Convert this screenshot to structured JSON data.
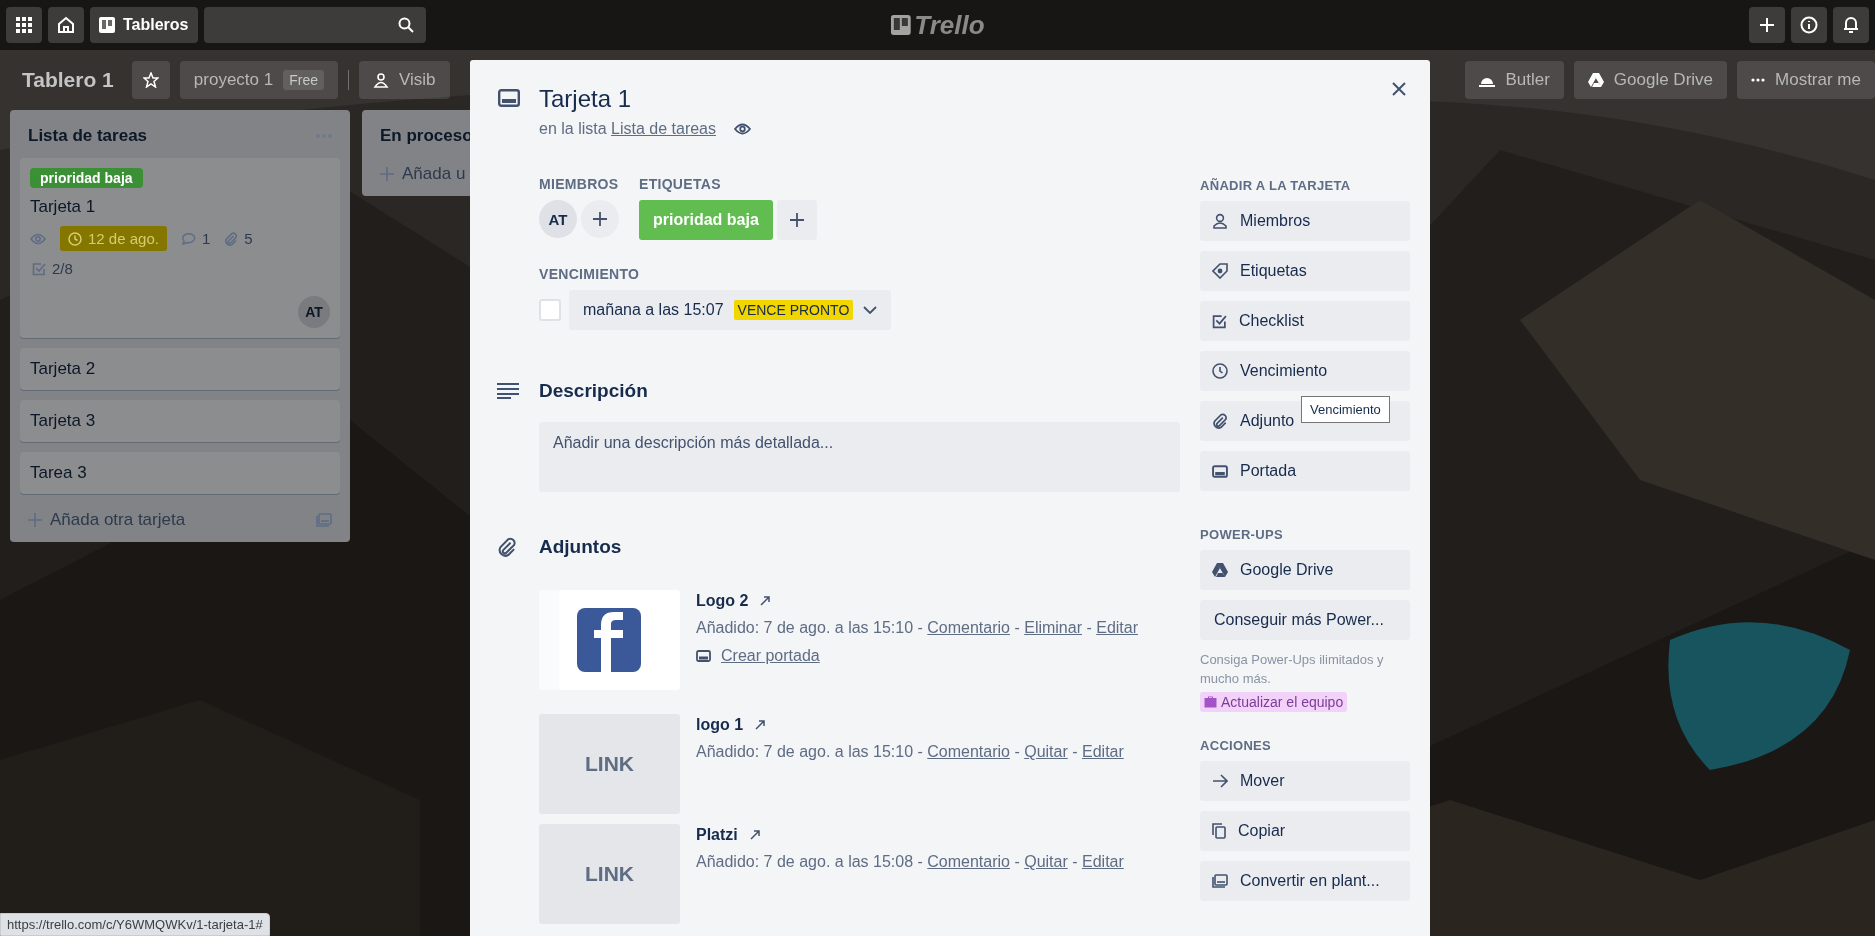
{
  "header": {
    "boards_button": "Tableros",
    "logo": "Trello"
  },
  "board": {
    "title": "Tablero 1",
    "starred": false,
    "team": "proyecto 1",
    "team_plan": "Free",
    "visibility": "Visib",
    "right_buttons": [
      "Butler",
      "Google Drive",
      "Mostrar me"
    ]
  },
  "lists": [
    {
      "title": "Lista de tareas",
      "cards": [
        {
          "title": "Tarjeta 1",
          "labels": [
            {
              "text": "prioridad baja",
              "color": "#3b8f35"
            }
          ],
          "watching": true,
          "due": "12 de ago.",
          "due_soon": true,
          "comments": "1",
          "attachments": "5",
          "checklist": "2/8",
          "members": [
            "AT"
          ]
        },
        {
          "title": "Tarjeta 2"
        },
        {
          "title": "Tarjeta 3"
        },
        {
          "title": "Tarea 3"
        }
      ],
      "add_label": "Añada otra tarjeta"
    },
    {
      "title": "En proceso",
      "add_label": "Añada u"
    }
  ],
  "card_detail": {
    "title": "Tarjeta 1",
    "list_prefix": "en la lista",
    "list_name": "Lista de tareas",
    "watching": true,
    "members_heading": "MIEMBROS",
    "members": [
      "AT"
    ],
    "labels_heading": "ETIQUETAS",
    "labels": [
      {
        "text": "prioridad baja",
        "color": "#61bd4f"
      }
    ],
    "due_heading": "VENCIMIENTO",
    "due_complete": false,
    "due_date": "mañana a las 15:07",
    "due_badge": "VENCE PRONTO",
    "description_heading": "Descripción",
    "description_placeholder": "Añadir una descripción más detallada...",
    "attachments_heading": "Adjuntos",
    "separator": "-",
    "attachments": [
      {
        "name": "Logo 2",
        "thumb": {
          "kind": "picture"
        },
        "added": "Añadido: 7 de ago. a las 15:10",
        "actions": [
          "Comentario",
          "Eliminar",
          "Editar"
        ],
        "cover_link": "Crear portada"
      },
      {
        "name": "logo 1",
        "thumb": {
          "kind": "link",
          "text": "LINK"
        },
        "added": "Añadido: 7 de ago. a las 15:10",
        "actions": [
          "Comentario",
          "Quitar",
          "Editar"
        ]
      },
      {
        "name": "Platzi",
        "thumb": {
          "kind": "link",
          "text": "LINK"
        },
        "added": "Añadido: 7 de ago. a las 15:08",
        "actions": [
          "Comentario",
          "Quitar",
          "Editar"
        ]
      }
    ]
  },
  "sidebar": [
    {
      "title": "AÑADIR A LA TARJETA",
      "buttons": [
        {
          "label": "Miembros"
        },
        {
          "label": "Etiquetas"
        },
        {
          "label": "Checklist"
        },
        {
          "label": "Vencimiento"
        },
        {
          "label": "Adjunto",
          "tooltip": "Vencimiento"
        },
        {
          "label": "Portada"
        }
      ]
    },
    {
      "title": "POWER-UPS",
      "buttons": [
        {
          "label": "Google Drive"
        },
        {
          "label": "Conseguir más Power..."
        }
      ],
      "note": "Consiga Power-Ups ilimitados y mucho más.",
      "upgrade": "Actualizar el equipo"
    },
    {
      "title": "ACCIONES",
      "buttons": [
        {
          "label": "Mover"
        },
        {
          "label": "Copiar"
        },
        {
          "label": "Convertir en plant..."
        }
      ]
    }
  ],
  "status_url": "https://trello.com/c/Y6WMQWKv/1-tarjeta-1#"
}
